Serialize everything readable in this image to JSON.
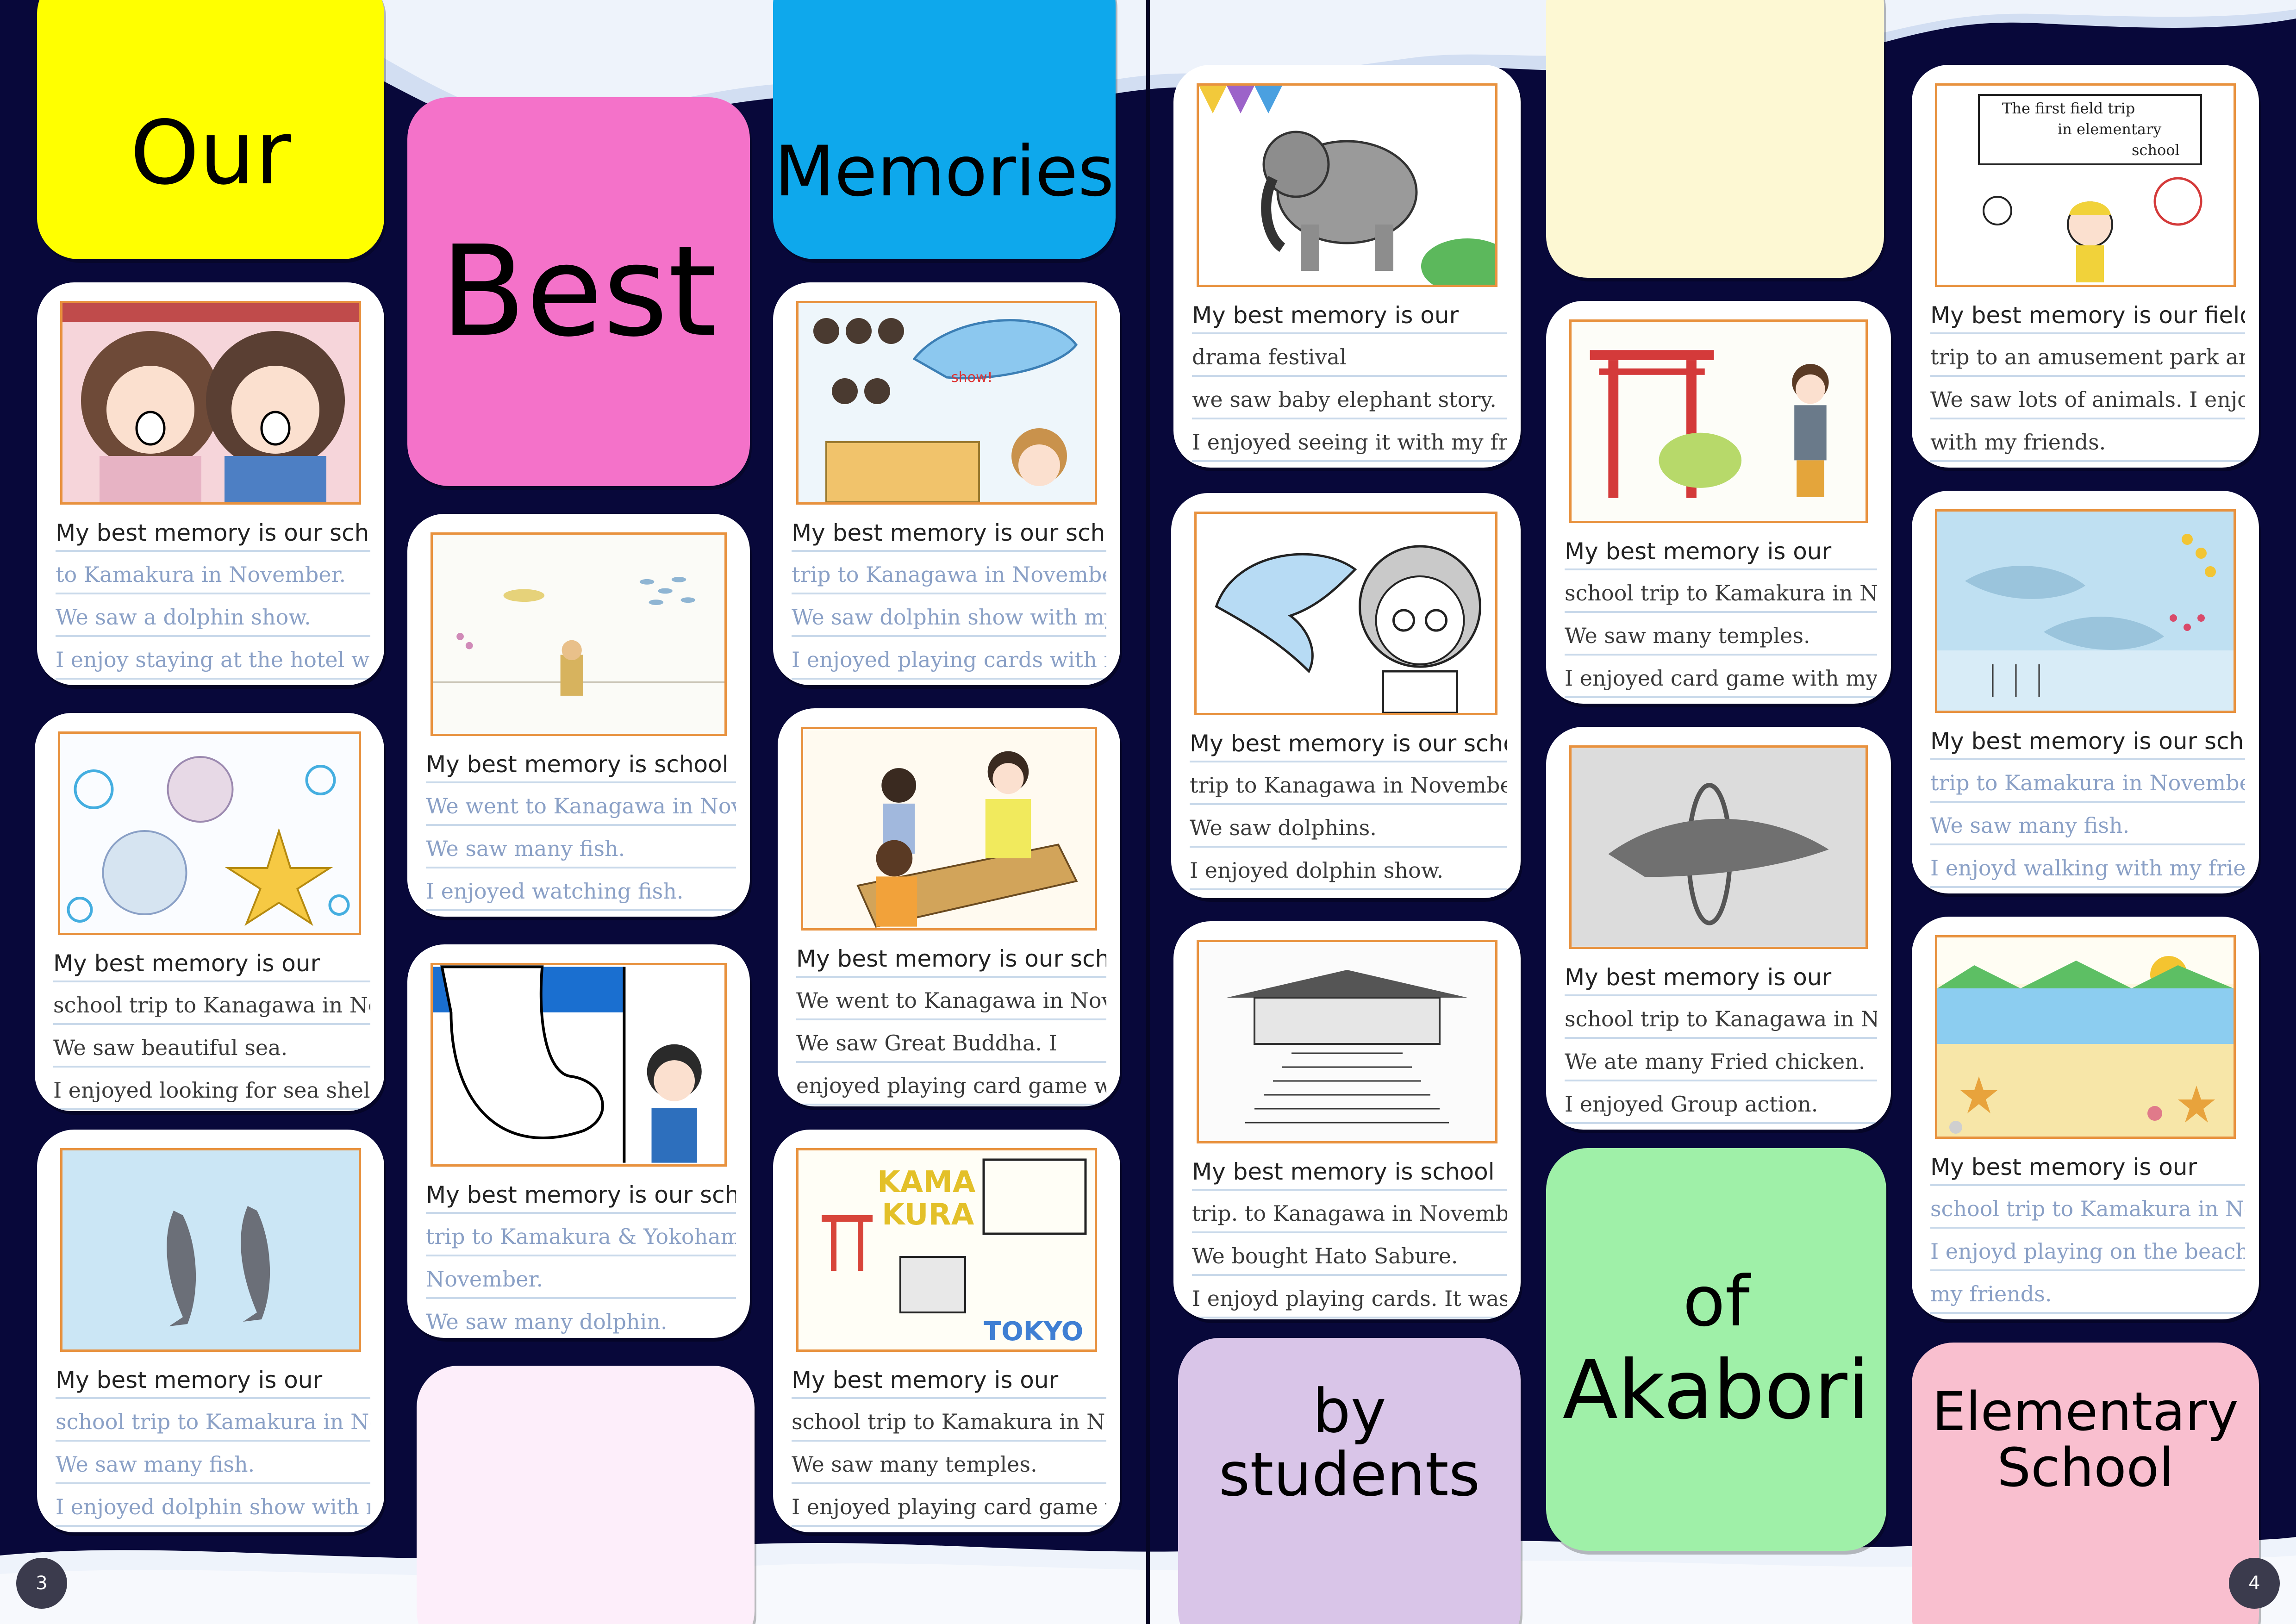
{
  "title_tiles": {
    "our": "Our",
    "best": "Best",
    "memories": "Memories",
    "by_students_1": "by",
    "by_students_2": "students",
    "of": "of",
    "akabori": "Akabori",
    "elementary": "Elementary",
    "school": "School"
  },
  "tile_colors": {
    "our": "#ffff00",
    "best": "#f472c9",
    "memories": "#0ea8ec",
    "blank_cream": "#fdf8d3",
    "blank_pink": "#fdeefa",
    "by_students": "#d9c5e8",
    "of_akabori": "#9ff0a8",
    "elementary_school": "#f9bfcf"
  },
  "drawing_labels": {
    "c3_show": "show!",
    "c12_kamakura_1": "KAMA",
    "c12_kamakura_2": "KURA",
    "c12_tokyo": "TOKYO",
    "c18_sign_1": "The first field trip",
    "c18_sign_2": "in elementary",
    "c18_sign_3": "school"
  },
  "cards": [
    {
      "id": "c1",
      "lines": [
        "My best memory is our school trip",
        "to Kamakura in November.",
        "We saw a dolphin show.",
        "I enjoy staying at the hotel with my friends."
      ]
    },
    {
      "id": "c2",
      "lines": [
        "My best memory is our",
        "school trip to Kanagawa in November.",
        "We saw beautiful sea.",
        "I enjoyed looking for sea shells."
      ]
    },
    {
      "id": "c3",
      "lines": [
        "My best memory is our",
        "school trip to Kamakura in November.",
        "We saw many fish.",
        "I enjoyed dolphin show with my friends."
      ]
    },
    {
      "id": "c4",
      "lines": [
        "My best memory is school trip",
        "We went to Kanagawa in November.",
        "We saw many fish.",
        "I enjoyed watching fish."
      ]
    },
    {
      "id": "c5",
      "lines": [
        "My best memory is our school",
        "trip to Kamakura & Yokohama in",
        "November.",
        "We saw many dolphin."
      ]
    },
    {
      "id": "c6",
      "lines": [
        "My best memory is our school",
        "trip to Kanagawa in November.",
        "We saw dolphin show with my friends.",
        "I enjoyed playing cards with my friends."
      ]
    },
    {
      "id": "c7",
      "lines": [
        "My best memory is our school trip.",
        "We went to Kanagawa in November.",
        "We saw Great Buddha. I",
        "enjoyed playing card game with my friends."
      ]
    },
    {
      "id": "c8",
      "lines": [
        "My best memory is our",
        "school trip to Kamakura in November.",
        "We saw many temples.",
        "I enjoyed playing card game with my friends."
      ]
    },
    {
      "id": "c9",
      "lines": [
        "My best memory is our",
        "drama festival",
        "we saw baby elephant story.",
        "I enjoyed seeing it with my friends."
      ]
    },
    {
      "id": "c10",
      "lines": [
        "My best memory is our school",
        "trip to Kanagawa in November",
        "We saw dolphins.",
        "I enjoyed dolphin show."
      ]
    },
    {
      "id": "c11",
      "lines": [
        "My best memory is school",
        "trip. to Kanagawa in November.",
        "We bought Hato Sabure.",
        "I enjoyd playing cards. It was fun."
      ]
    },
    {
      "id": "c12",
      "lines": [
        "My best memory is our",
        "school trip to Kamakura in November.",
        "We saw many temples.",
        "I enjoyed card game with my friends."
      ]
    },
    {
      "id": "c13",
      "lines": [
        "My best memory is our",
        "school trip to Kanagawa in November.",
        "We ate many Fried chicken.",
        "I enjoyed Group action."
      ]
    },
    {
      "id": "c14",
      "lines": [
        "My best memory is our field",
        "trip to an amusement park and zoo.",
        "We saw lots of animals. I enjoyed playing",
        "with my friends."
      ]
    },
    {
      "id": "c15",
      "lines": [
        "My best memory is our school",
        "trip to Kamakura in November.",
        "We saw many fish.",
        "I enjoyd walking with my friends."
      ]
    },
    {
      "id": "c16",
      "lines": [
        "My best memory is our",
        "school trip to Kamakura in November.",
        "I enjoyd playing on the beach with",
        "my friends."
      ]
    }
  ],
  "page_numbers": {
    "left": "3",
    "right": "4"
  }
}
